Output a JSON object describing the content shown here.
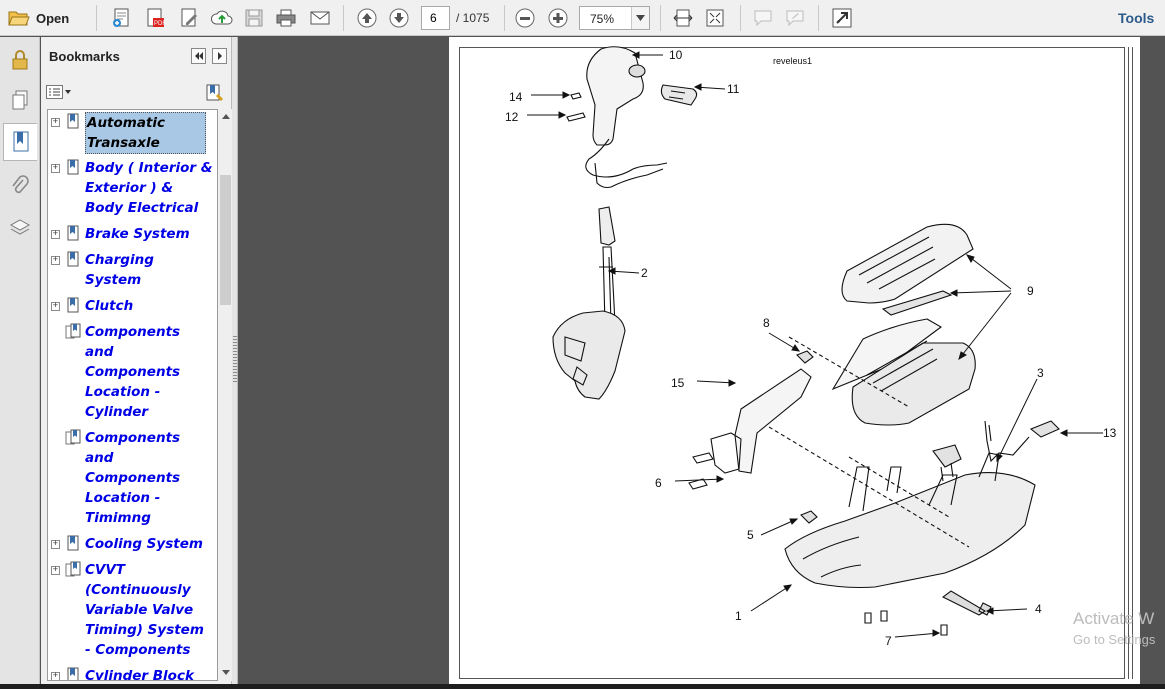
{
  "toolbar": {
    "open_label": "Open",
    "current_page": "6",
    "page_total": "/ 1075",
    "zoom": "75%",
    "tools_label": "Tools"
  },
  "panel": {
    "title": "Bookmarks"
  },
  "bookmarks": [
    {
      "label": "Automatic\nTransaxle",
      "selected": true,
      "type": "single",
      "expandable": true
    },
    {
      "label": "Body ( Interior &\nExterior ) &\nBody Electrical",
      "type": "single",
      "expandable": true
    },
    {
      "label": "Brake System",
      "type": "single",
      "expandable": true
    },
    {
      "label": "Charging\nSystem",
      "type": "single",
      "expandable": true
    },
    {
      "label": "Clutch",
      "type": "single",
      "expandable": true
    },
    {
      "label": "Components\nand\nComponents\nLocation -\nCylinder",
      "type": "multi",
      "expandable": false
    },
    {
      "label": "Components\nand\nComponents\nLocation -\nTimimng",
      "type": "multi",
      "expandable": false
    },
    {
      "label": "Cooling System",
      "type": "single",
      "expandable": true
    },
    {
      "label": "CVVT\n(Continuously\nVariable Valve\nTiming) System\n- Components",
      "type": "multi",
      "expandable": true
    },
    {
      "label": "Cylinder Block",
      "type": "single",
      "expandable": true
    }
  ],
  "document": {
    "label": "reveleus1",
    "callouts": [
      "10",
      "11",
      "14",
      "12",
      "2",
      "9",
      "8",
      "3",
      "15",
      "13",
      "6",
      "5",
      "1",
      "4",
      "7"
    ]
  },
  "watermark": {
    "line1": "Activate W",
    "line2": "Go to Settings"
  },
  "colors": {
    "link": "#0000e6",
    "selected_bg": "#a9c8e6",
    "doc_bg": "#535353",
    "tools": "#2b5a8a"
  }
}
